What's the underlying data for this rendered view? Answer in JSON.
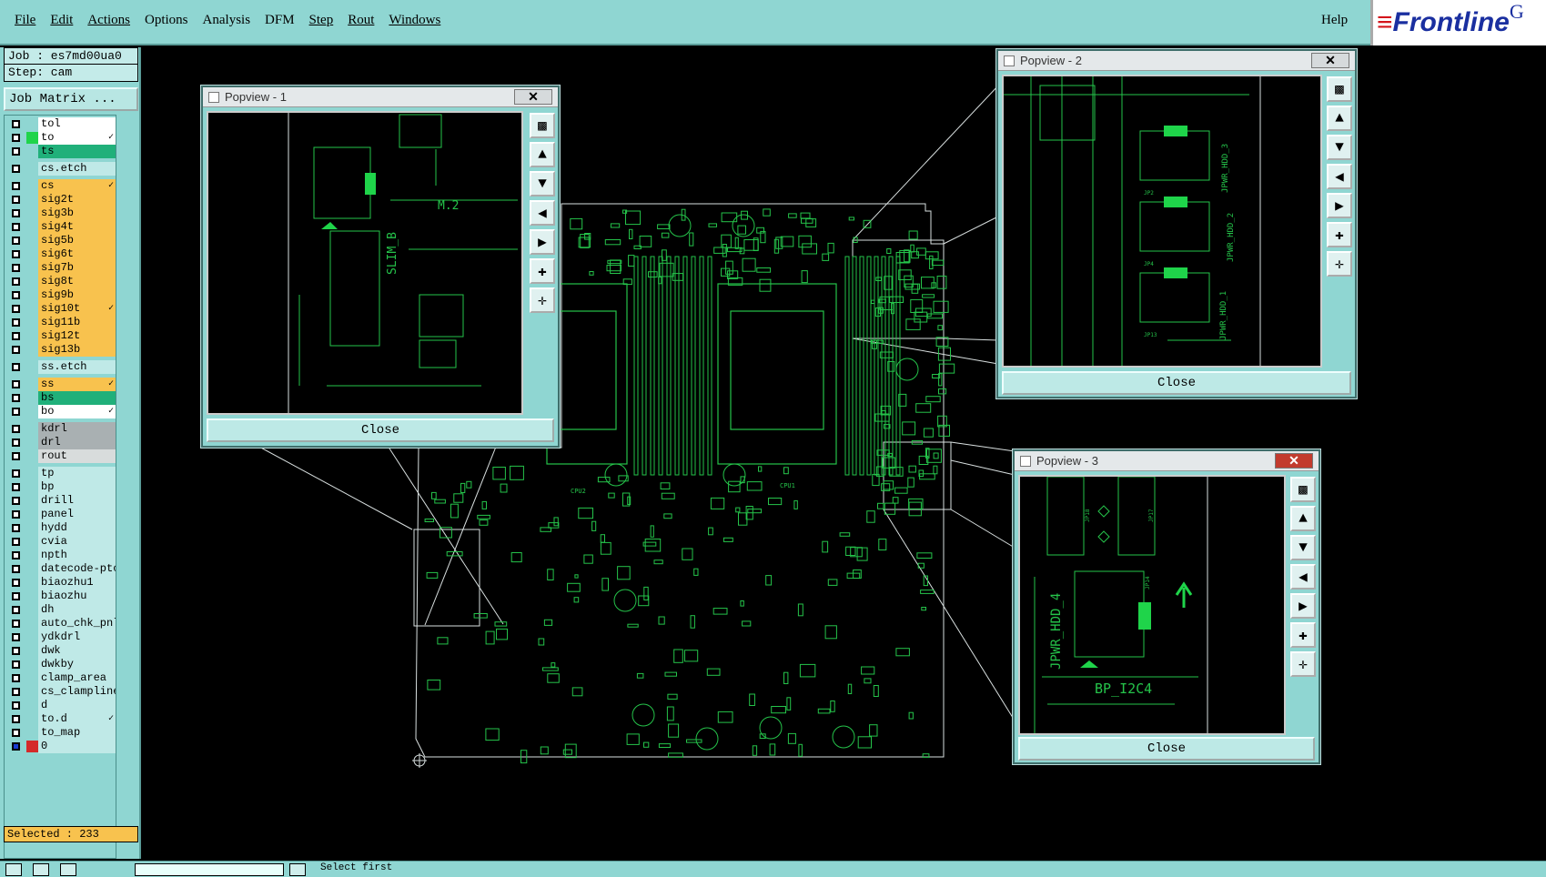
{
  "menubar": {
    "items": [
      "File",
      "Edit",
      "Actions",
      "Options",
      "Analysis",
      "DFM",
      "Step",
      "Rout",
      "Windows"
    ],
    "help": "Help"
  },
  "logo": {
    "brand": "Frontline",
    "suffix": "G"
  },
  "job": {
    "job_label": "Job : es7md00ua0",
    "step_label": "Step: cam",
    "matrix_button": "Job Matrix ..."
  },
  "layers": [
    {
      "name": "tol",
      "color": "white"
    },
    {
      "name": "to",
      "color": "white",
      "swatch": "#1fd44a",
      "mark": "✓"
    },
    {
      "name": "ts",
      "color": "green"
    },
    {
      "name": "cs.etch",
      "color": "cyan",
      "gap": true
    },
    {
      "name": "cs",
      "color": "orange",
      "gap": true,
      "mark": "✓"
    },
    {
      "name": "sig2t",
      "color": "orange"
    },
    {
      "name": "sig3b",
      "color": "orange"
    },
    {
      "name": "sig4t",
      "color": "orange"
    },
    {
      "name": "sig5b",
      "color": "orange"
    },
    {
      "name": "sig6t",
      "color": "orange"
    },
    {
      "name": "sig7b",
      "color": "orange"
    },
    {
      "name": "sig8t",
      "color": "orange"
    },
    {
      "name": "sig9b",
      "color": "orange"
    },
    {
      "name": "sig10t",
      "color": "orange",
      "mark": "✓"
    },
    {
      "name": "sig11b",
      "color": "orange"
    },
    {
      "name": "sig12t",
      "color": "orange"
    },
    {
      "name": "sig13b",
      "color": "orange"
    },
    {
      "name": "ss.etch",
      "color": "cyan",
      "gap": true
    },
    {
      "name": "ss",
      "color": "orange",
      "gap": true,
      "mark": "✓"
    },
    {
      "name": "bs",
      "color": "green"
    },
    {
      "name": "bo",
      "color": "white",
      "mark": "✓"
    },
    {
      "name": "kdrl",
      "color": "grey",
      "gap": true
    },
    {
      "name": "drl",
      "color": "grey"
    },
    {
      "name": "rout",
      "color": "lgrey"
    },
    {
      "name": "tp",
      "color": "cyan",
      "gap": true
    },
    {
      "name": "bp",
      "color": "cyan"
    },
    {
      "name": "drill",
      "color": "cyan"
    },
    {
      "name": "panel",
      "color": "cyan"
    },
    {
      "name": "hydd",
      "color": "cyan"
    },
    {
      "name": "cvia",
      "color": "cyan"
    },
    {
      "name": "npth",
      "color": "cyan"
    },
    {
      "name": "datecode-ptc",
      "color": "cyan"
    },
    {
      "name": "biaozhu1",
      "color": "cyan"
    },
    {
      "name": "biaozhu",
      "color": "cyan"
    },
    {
      "name": "dh",
      "color": "cyan"
    },
    {
      "name": "auto_chk_pnl",
      "color": "cyan"
    },
    {
      "name": "ydkdrl",
      "color": "cyan"
    },
    {
      "name": "dwk",
      "color": "cyan"
    },
    {
      "name": "dwkby",
      "color": "cyan"
    },
    {
      "name": "clamp_area",
      "color": "cyan"
    },
    {
      "name": "cs_clampline",
      "color": "cyan"
    },
    {
      "name": "d",
      "color": "cyan"
    },
    {
      "name": "to.d",
      "color": "cyan",
      "mark": "✓"
    },
    {
      "name": "to_map",
      "color": "cyan"
    },
    {
      "name": "0",
      "color": "cyan",
      "special": true
    }
  ],
  "selected": "Selected : 233",
  "popviews": [
    {
      "title": "Popview - 1",
      "close": "Close",
      "labels": [
        "M.2",
        "SLIM_B"
      ]
    },
    {
      "title": "Popview - 2",
      "close": "Close",
      "labels": [
        "JPWR_HDD_3",
        "JPWR_HDD_2",
        "JPWR_HDD_1",
        "JP2",
        "JP4",
        "JP13"
      ]
    },
    {
      "title": "Popview - 3",
      "close": "Close",
      "labels": [
        "JPWR_HDD_4",
        "BP_I2C4",
        "JP18",
        "JP17",
        "JP14"
      ]
    }
  ],
  "board_labels": [
    "CPU2",
    "CPU1"
  ],
  "status_message": "Select first",
  "colors": {
    "ui": "#8fd6d2",
    "trace": "#25c34a",
    "pad": "#1fd44a",
    "outline": "#cfd8d8"
  }
}
